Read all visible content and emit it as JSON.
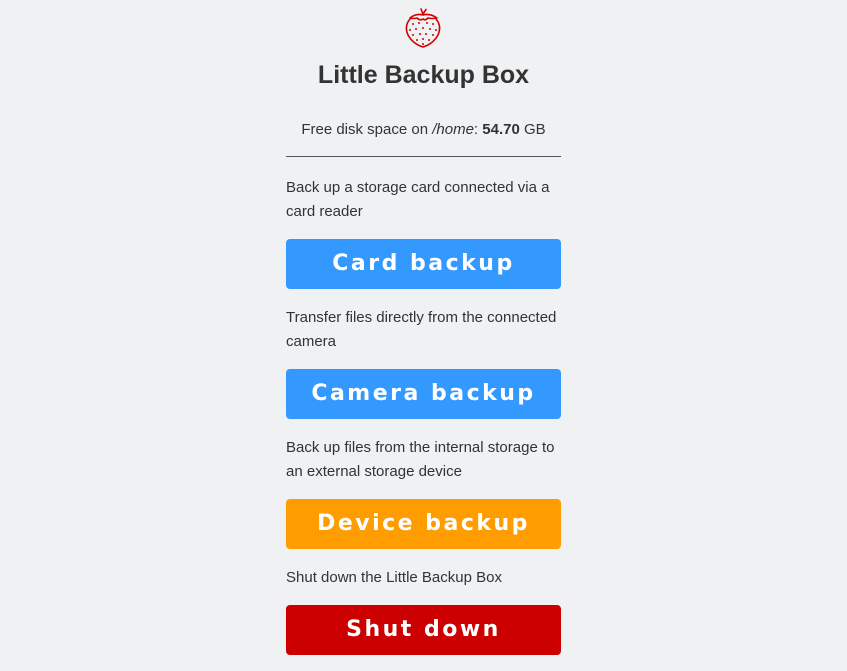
{
  "header": {
    "logo_icon": "strawberry-icon",
    "title": "Little Backup Box"
  },
  "disk": {
    "prefix": "Free disk space on",
    "path": "/home",
    "separator": ":",
    "amount": "54.70",
    "unit": "GB"
  },
  "sections": {
    "card": {
      "description": "Back up a storage card connected via a card reader",
      "button_label": "Card backup"
    },
    "camera": {
      "description": "Transfer files directly from the connected camera",
      "button_label": "Camera backup"
    },
    "device": {
      "description": "Back up files from the internal storage to an external storage device",
      "button_label": "Device backup"
    },
    "shutdown": {
      "description": "Shut down the Little Backup Box",
      "button_label": "Shut down"
    }
  },
  "colors": {
    "background": "#eff1f3",
    "blue_button": "#3399ff",
    "orange_button": "#ff9c00",
    "red_button": "#cc0000",
    "logo": "#d40000"
  }
}
